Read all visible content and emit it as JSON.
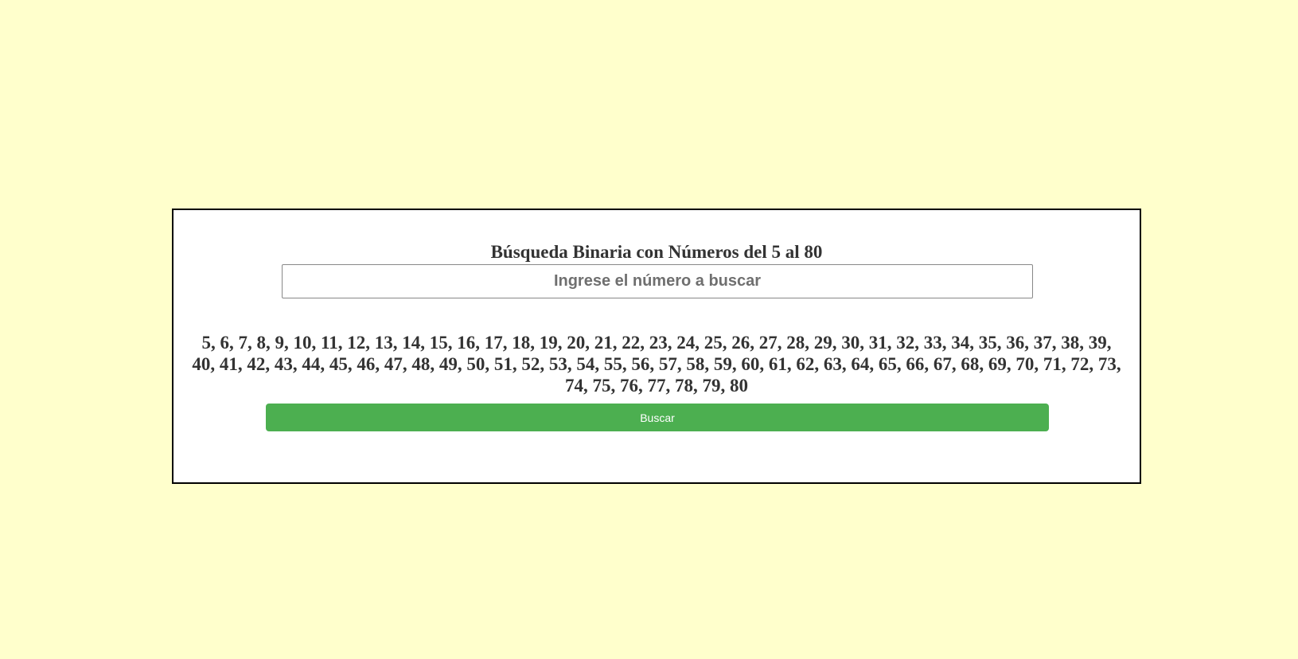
{
  "page": {
    "background_color": "#ffffcc"
  },
  "card": {
    "title": "Búsqueda Binaria con Números del 5 al 80",
    "search": {
      "value": "",
      "placeholder": "Ingrese el número a buscar"
    },
    "numbers_text": "5, 6, 7, 8, 9, 10, 11, 12, 13, 14, 15, 16, 17, 18, 19, 20, 21, 22, 23, 24, 25, 26, 27, 28, 29, 30, 31, 32, 33, 34, 35, 36, 37, 38, 39, 40, 41, 42, 43, 44, 45, 46, 47, 48, 49, 50, 51, 52, 53, 54, 55, 56, 57, 58, 59, 60, 61, 62, 63, 64, 65, 66, 67, 68, 69, 70, 71, 72, 73, 74, 75, 76, 77, 78, 79, 80",
    "button_label": "Buscar",
    "button_color": "#4caf50"
  }
}
